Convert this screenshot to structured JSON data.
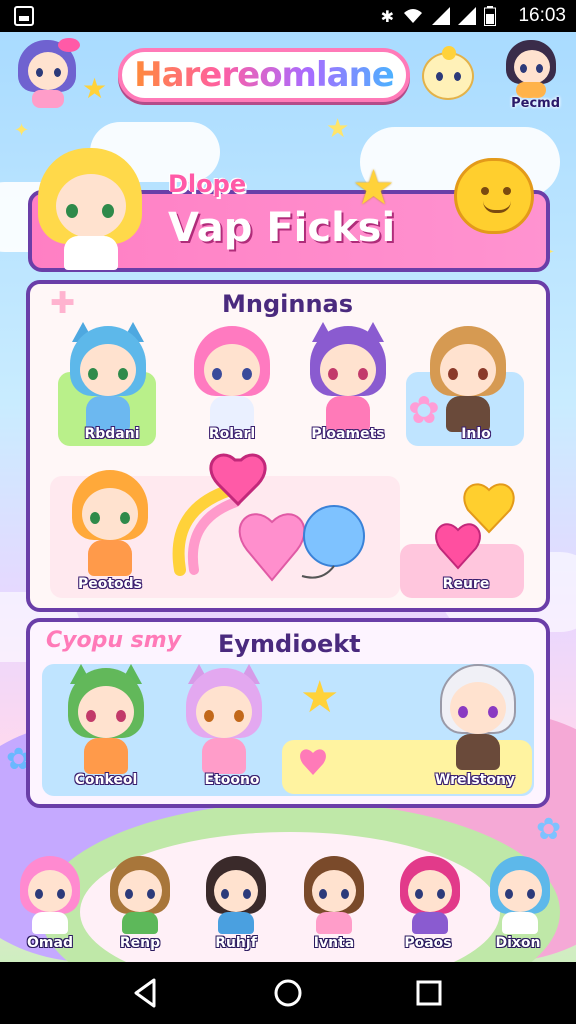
{
  "status_bar": {
    "time": "16:03"
  },
  "header": {
    "logo_text": "Harereomlane",
    "top_right_label": "Pecmd"
  },
  "banner": {
    "small_text": "Dlope",
    "title": "Vap Ficksi"
  },
  "panel1": {
    "title": "Mnginnas",
    "characters": [
      {
        "label": "Rbdani"
      },
      {
        "label": "Rolarl"
      },
      {
        "label": "Ploamets"
      },
      {
        "label": "Inlo"
      },
      {
        "label": "Peotods"
      },
      {
        "label": "Reure"
      }
    ]
  },
  "panel2": {
    "tag_text": "Cyopu smy",
    "title": "Eymdioekt",
    "characters": [
      {
        "label": "Conkeol"
      },
      {
        "label": "Etoono"
      },
      {
        "label": "Wrelstony"
      }
    ]
  },
  "bottom_row": {
    "characters": [
      {
        "label": "Omad"
      },
      {
        "label": "Renp"
      },
      {
        "label": "Ruhjf"
      },
      {
        "label": "Ivnta"
      },
      {
        "label": "Poaos"
      },
      {
        "label": "Dixon"
      }
    ]
  },
  "nav_bar": {
    "back": "back-icon",
    "home": "home-icon",
    "recents": "recents-icon"
  },
  "colors": {
    "accent": "#ff5aa7",
    "border": "#6a3ea8",
    "banner": "#ff7fc4"
  }
}
